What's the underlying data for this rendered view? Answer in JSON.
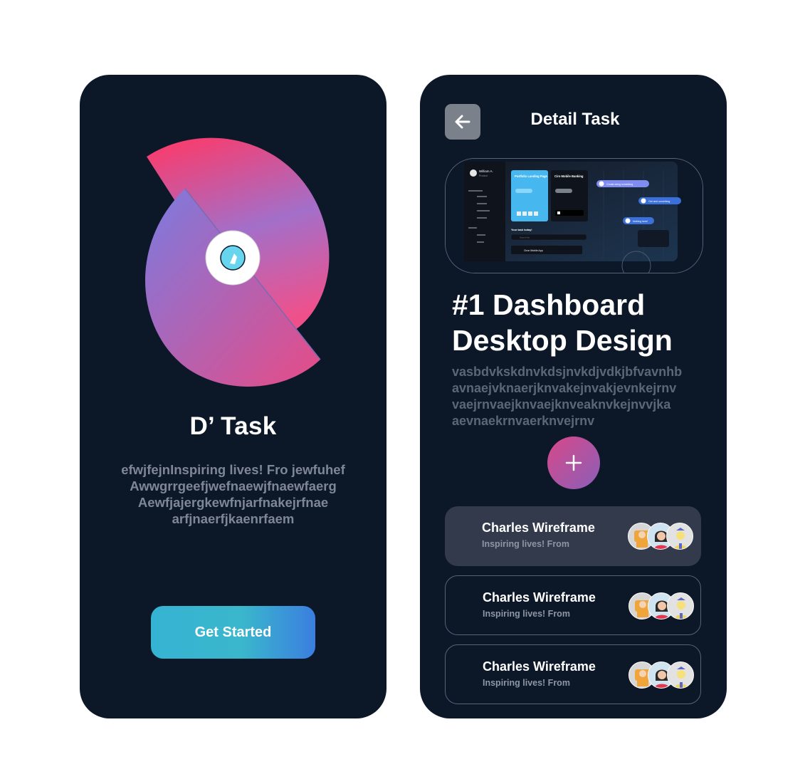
{
  "splash": {
    "app_name": "D’ Task",
    "tagline_lines": [
      "efwjfejnInspiring lives! Fro jewfuhef",
      "Awwgrrgeefjwefnaewjfnaewfaerg",
      "Aewfjajergkewfnjarfnakejrfnae",
      "arfjnaerfjkaenrfaem"
    ],
    "cta_label": "Get Started"
  },
  "detail": {
    "screen_title": "Detail Task",
    "heading_lines": [
      "#1 Dashboard",
      "Desktop Design"
    ],
    "description_lines": [
      "vasbdvkskdnvkdsjnvkdjvdkjbfvavnhb",
      "avnaejvknaerjknvakejnvakjevnkejrnv",
      "vaejrnvaejknvaejknveaknvkejnvvjka",
      "aevnaekrnvaerknvejrnv"
    ],
    "preview": {
      "user_name": "William A.",
      "user_role": "Product",
      "card1_title": "Portfolio Landing Page",
      "card2_title": "Ciro Mobile Banking",
      "search_placeholder": "Search list",
      "section_label": "Your task today!",
      "list_item": "Ciron Mobile App",
      "chat_1": "Create doing something",
      "chat_2": "Get next something",
      "chat_3": "Nothing here!"
    },
    "tasks": [
      {
        "title": "Charles Wireframe",
        "subtitle": "Inspiring lives! From",
        "state": "active"
      },
      {
        "title": "Charles Wireframe",
        "subtitle": "Inspiring lives! From",
        "state": "default"
      },
      {
        "title": "Charles Wireframe",
        "subtitle": "Inspiring lives! From",
        "state": "default"
      }
    ]
  },
  "colors": {
    "background": "#0c1728",
    "logo_pink": "#ea4c86",
    "logo_purple": "#7e7bd8",
    "cta_start": "#35b3d3",
    "cta_end": "#3b7ee0",
    "active_card": "#323a4c",
    "muted_text": "#7f8796"
  },
  "icons": [
    "app-logo-icon",
    "back-arrow-icon",
    "plus-icon",
    "avatar-icon"
  ]
}
